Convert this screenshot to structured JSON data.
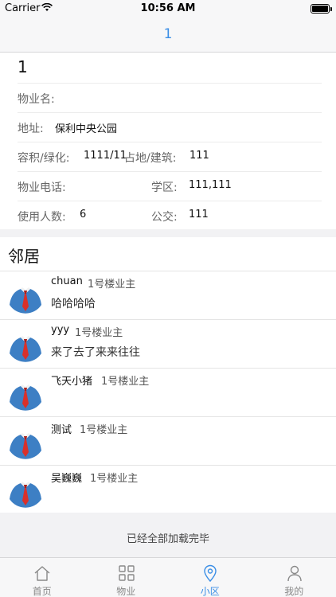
{
  "status_bar": {
    "carrier": "Carrier",
    "time": "10:56 AM"
  },
  "nav": {
    "title": "1"
  },
  "property": {
    "name": "1",
    "manager_label": "物业名:",
    "manager_value": "",
    "address_label": "地址:",
    "address_value": "保利中央公园",
    "ratio_label": "容积/绿化:",
    "ratio_value": "1111/11",
    "area_label": "占地/建筑:",
    "area_value": "111",
    "phone_label": "物业电话:",
    "phone_value": "",
    "school_label": "学区:",
    "school_value": "111,111",
    "users_label": "使用人数:",
    "users_value": "6",
    "bus_label": "公交:",
    "bus_value": "111"
  },
  "neighbors": {
    "title": "邻居",
    "items": [
      {
        "name": "chuan",
        "tag": "1号楼业主",
        "message": "哈哈哈哈"
      },
      {
        "name": "yyy",
        "tag": "1号楼业主",
        "message": "来了去了来来往往"
      },
      {
        "name": "飞天小猪",
        "tag": "1号楼业主",
        "message": ""
      },
      {
        "name": "测试",
        "tag": "1号楼业主",
        "message": ""
      },
      {
        "name": "吴巍巍",
        "tag": "1号楼业主",
        "message": ""
      }
    ],
    "footer": "已经全部加载完毕"
  },
  "tabs": [
    {
      "label": "首页",
      "icon": "home-icon",
      "active": false
    },
    {
      "label": "物业",
      "icon": "grid-icon",
      "active": false
    },
    {
      "label": "小区",
      "icon": "location-pin-icon",
      "active": true
    },
    {
      "label": "我的",
      "icon": "person-icon",
      "active": false
    }
  ],
  "colors": {
    "accent": "#3a8ee6",
    "avatar_bg": "#3d7fc4",
    "tie": "#d9302a"
  }
}
